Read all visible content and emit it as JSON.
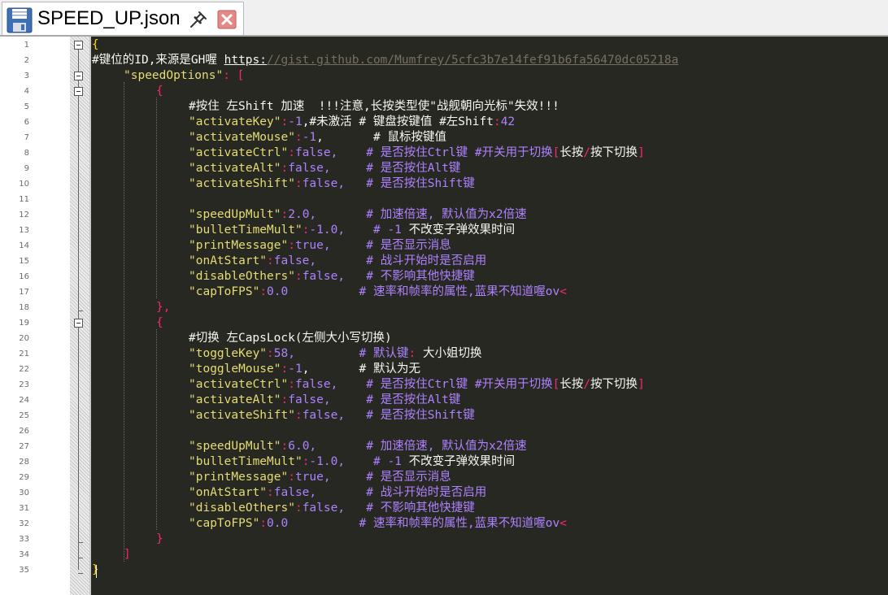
{
  "tab": {
    "title": "SPEED_UP.json"
  },
  "line_numbers": [
    "1",
    "2",
    "3",
    "4",
    "5",
    "6",
    "7",
    "8",
    "9",
    "10",
    "11",
    "12",
    "13",
    "14",
    "15",
    "16",
    "17",
    "18",
    "19",
    "20",
    "21",
    "22",
    "23",
    "24",
    "25",
    "26",
    "27",
    "28",
    "29",
    "30",
    "31",
    "32",
    "33",
    "34",
    "35"
  ],
  "code": {
    "l1": "{",
    "l2a": "#键位的ID,来源是GH喔 ",
    "l2b": "https:",
    "l2c": "//gist.github.com/Mumfrey/5cfc3b7e14fef91b6fa56470dc05218a",
    "l3a": "\"speedOptions\"",
    "l3b": ": [",
    "l4": "{",
    "l5": "#按住 左Shift 加速  !!!注意,长按类型使\"战舰朝向光标\"失效!!!",
    "l6": [
      "\"activateKey\"",
      ":",
      "-1",
      ",#未激活 # 键盘按键值 #左Shift",
      ":",
      "42"
    ],
    "l7": [
      "\"activateMouse\"",
      ":",
      "-1",
      ",       # 鼠标按键值"
    ],
    "l8": [
      "\"activateCtrl\"",
      ":",
      "false,    # 是否按住Ctrl键 #开关用于切换",
      "[",
      "长按",
      "/",
      "按下切换",
      "]"
    ],
    "l9": [
      "\"activateAlt\"",
      ":",
      "false,     # 是否按住Alt键"
    ],
    "l10": [
      "\"activateShift\"",
      ":",
      "false,   # 是否按住Shift键"
    ],
    "l12": [
      "\"speedUpMult\"",
      ":",
      "2.0,       # 加速倍速, 默认值为x2倍速"
    ],
    "l13": [
      "\"bulletTimeMult\"",
      ":",
      "-1.0,    # ",
      "-1",
      " 不改变子弹效果时间"
    ],
    "l14": [
      "\"printMessage\"",
      ":",
      "true,     # 是否显示消息"
    ],
    "l15": [
      "\"onAtStart\"",
      ":",
      "false,       # 战斗开始时是否启用"
    ],
    "l16": [
      "\"disableOthers\"",
      ":",
      "false,   # 不影响其他快捷键"
    ],
    "l17": [
      "\"capToFPS\"",
      ":",
      "0.0          # 速率和帧率的属性,蓝果不知道喔ov",
      "<"
    ],
    "l18": "},",
    "l19": "{",
    "l20": "#切换 左CapsLock(左侧大小写切换)",
    "l21": [
      "\"toggleKey\"",
      ":",
      "58,         # 默认键",
      ":",
      " 大小姐切换"
    ],
    "l22": [
      "\"toggleMouse\"",
      ":",
      "-1",
      ",       # 默认为无"
    ],
    "l23": [
      "\"activateCtrl\"",
      ":",
      "false,    # 是否按住Ctrl键 #开关用于切换",
      "[",
      "长按",
      "/",
      "按下切换",
      "]"
    ],
    "l24": [
      "\"activateAlt\"",
      ":",
      "false,     # 是否按住Alt键"
    ],
    "l25": [
      "\"activateShift\"",
      ":",
      "false,   # 是否按住Shift键"
    ],
    "l27": [
      "\"speedUpMult\"",
      ":",
      "6.0,       # 加速倍速, 默认值为x2倍速"
    ],
    "l28": [
      "\"bulletTimeMult\"",
      ":",
      "-1.0,    # ",
      "-1",
      " 不改变子弹效果时间"
    ],
    "l29": [
      "\"printMessage\"",
      ":",
      "true,     # 是否显示消息"
    ],
    "l30": [
      "\"onAtStart\"",
      ":",
      "false,       # 战斗开始时是否启用"
    ],
    "l31": [
      "\"disableOthers\"",
      ":",
      "false,   # 不影响其他快捷键"
    ],
    "l32": [
      "\"capToFPS\"",
      ":",
      "0.0          # 速率和帧率的属性,蓝果不知道喔ov",
      "<"
    ],
    "l33": "}",
    "l34": "]",
    "l35": "}"
  },
  "colors": {
    "background": "#272822",
    "key": "#e6db74",
    "punct": "#f92672",
    "number": "#ae81ff",
    "text": "#f8f8f2"
  },
  "icons": [
    "save-icon",
    "pin-icon",
    "close-icon",
    "fold-box-icon"
  ]
}
